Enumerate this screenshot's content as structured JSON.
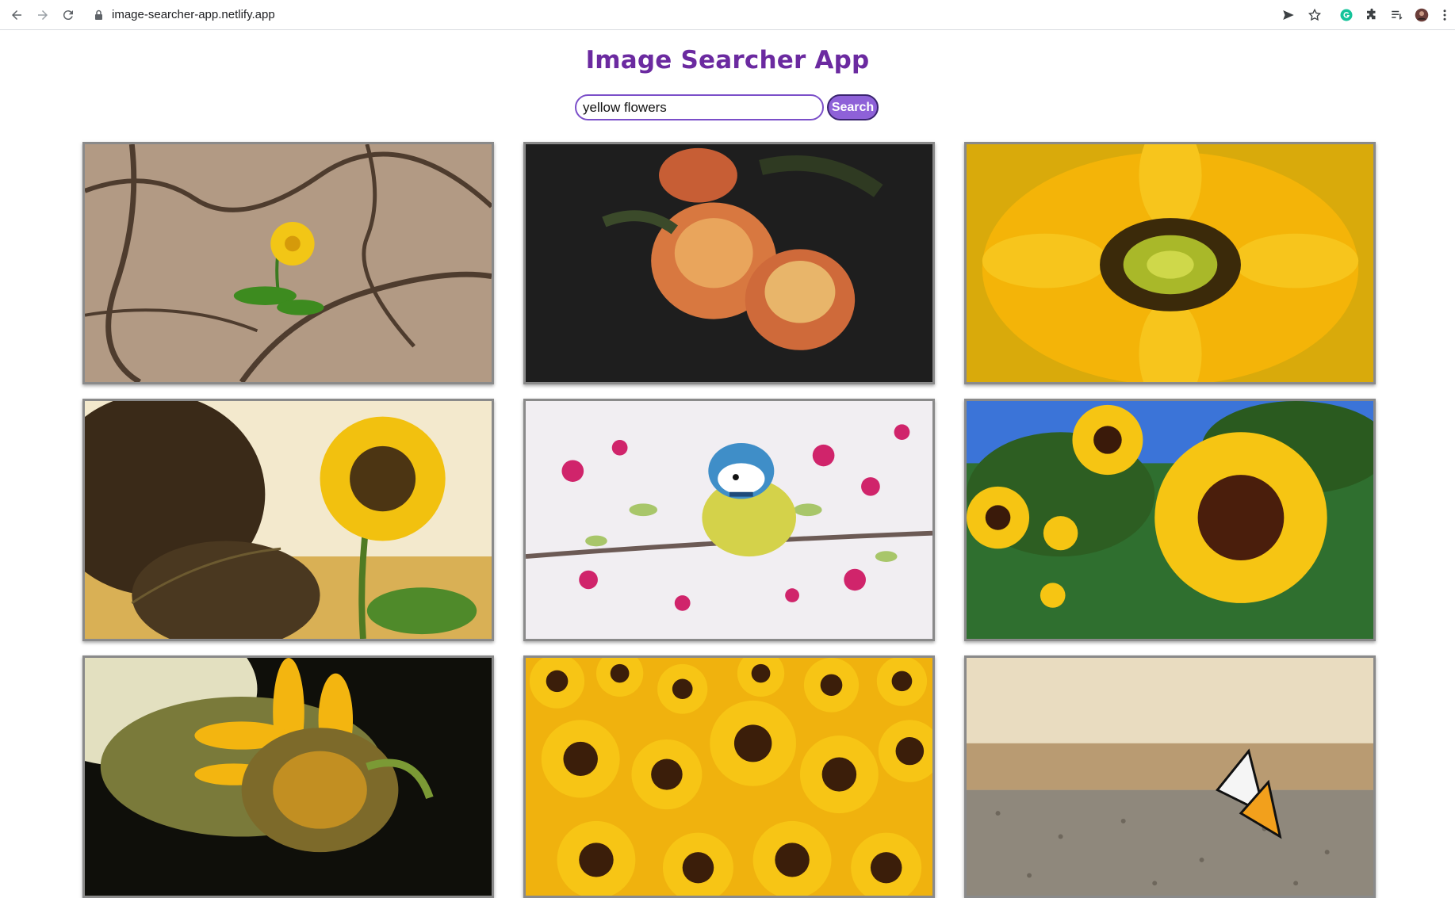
{
  "browser": {
    "url": "image-searcher-app.netlify.app",
    "icons": [
      "back-icon",
      "forward-icon",
      "reload-icon",
      "lock-icon",
      "send-icon",
      "star-icon",
      "grammarly-icon",
      "extensions-icon",
      "reading-list-icon",
      "profile-avatar",
      "menu-icon"
    ]
  },
  "app": {
    "title": "Image Searcher App",
    "search": {
      "value": "yellow flowers",
      "button_label": "Search"
    }
  },
  "results": [
    {
      "subject": "yellow flower growing in cracked earth"
    },
    {
      "subject": "orange and yellow roses on dark background"
    },
    {
      "subject": "sunflower close-up on yellow background"
    },
    {
      "subject": "sunflower at sunset with grass"
    },
    {
      "subject": "blue tit bird on pink blossom branch"
    },
    {
      "subject": "sunflowers under blue sky"
    },
    {
      "subject": "sunflower side view on dark background"
    },
    {
      "subject": "field of sunflowers"
    },
    {
      "subject": "butterfly on gravel"
    }
  ],
  "colors": {
    "title": "#6b2aa0",
    "search_border": "#7b4fc9",
    "button_bg": "#8e61d8"
  }
}
